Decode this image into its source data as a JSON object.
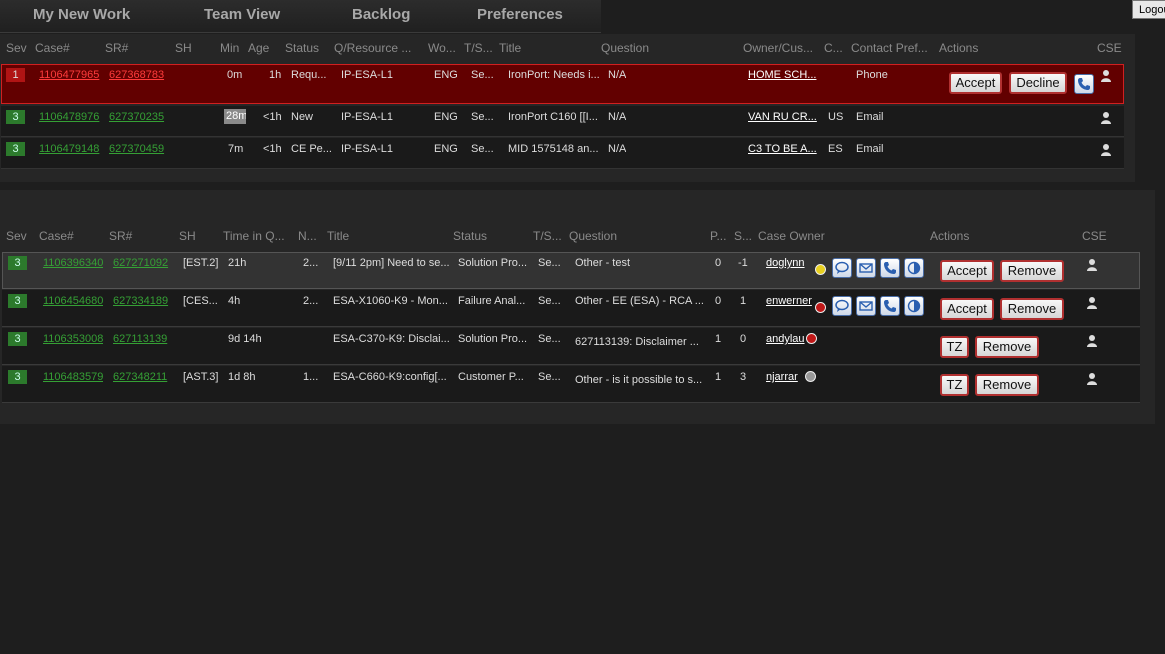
{
  "nav": {
    "tabs": [
      "My New Work",
      "Team View",
      "Backlog",
      "Preferences"
    ],
    "logout": "Logout"
  },
  "colors": {
    "accent_red": "#b01414",
    "sev_green": "#2c7a2c",
    "link_green": "#35a035",
    "link_red": "#ff3b3b"
  },
  "new_work": {
    "headers": [
      "Sev",
      "Case#",
      "SR#",
      "SH",
      "Min",
      "Age",
      "Status",
      "Q/Resource ...",
      "Wo...",
      "T/S...",
      "Title",
      "Question",
      "Owner/Cus...",
      "C...",
      "Contact Pref...",
      "Actions",
      "CSE"
    ],
    "rows": [
      {
        "sev": "1",
        "case": "1106477965",
        "sr": "627368783",
        "sh": "",
        "min": "0m",
        "age": "1h",
        "status": "Requ...",
        "queue": "IP-ESA-L1",
        "wo": "ENG",
        "ts": "Se...",
        "title": "IronPort: Needs i...",
        "question": "N/A",
        "owner": "HOME SCH...",
        "country": "",
        "contact": "Phone",
        "actions": [
          "Accept",
          "Decline"
        ]
      },
      {
        "sev": "3",
        "case": "1106478976",
        "sr": "627370235",
        "sh": "",
        "min": "28m",
        "age": "<1h",
        "status": "New",
        "queue": "IP-ESA-L1",
        "wo": "ENG",
        "ts": "Se...",
        "title": "IronPort C160 [[I...",
        "question": "N/A",
        "owner": "VAN RU CR...",
        "country": "US",
        "contact": "Email",
        "actions": []
      },
      {
        "sev": "3",
        "case": "1106479148",
        "sr": "627370459",
        "sh": "",
        "min": "7m",
        "age": "<1h",
        "status": "CE Pe...",
        "queue": "IP-ESA-L1",
        "wo": "ENG",
        "ts": "Se...",
        "title": "MID 1575148 an...",
        "question": "N/A",
        "owner": "C3 TO BE A...",
        "country": "ES",
        "contact": "Email",
        "actions": []
      }
    ]
  },
  "team": {
    "headers": [
      "Sev",
      "Case#",
      "SR#",
      "SH",
      "Time in Q...",
      "N...",
      "Title",
      "Status",
      "T/S...",
      "Question",
      "P...",
      "S...",
      "Case Owner",
      "Actions",
      "CSE"
    ],
    "rows": [
      {
        "sev": "3",
        "case": "1106396340",
        "sr": "627271092",
        "sh": "[EST.2]",
        "time": "21h",
        "n": "2...",
        "title": "[9/11 2pm] Need to se...",
        "status": "Solution Pro...",
        "ts": "Se...",
        "question": "Other - test",
        "p": "0",
        "s": "-1",
        "owner": "doglynn",
        "presence": "yellow",
        "actions": [
          "Accept",
          "Remove"
        ]
      },
      {
        "sev": "3",
        "case": "1106454680",
        "sr": "627334189",
        "sh": "[CES...",
        "time": "4h",
        "n": "2...",
        "title": "ESA-X1060-K9 - Mon...",
        "status": "Failure Anal...",
        "ts": "Se...",
        "question": "Other - EE (ESA) - RCA ...",
        "p": "0",
        "s": "1",
        "owner": "enwerner",
        "presence": "red",
        "actions": [
          "Accept",
          "Remove"
        ]
      },
      {
        "sev": "3",
        "case": "1106353008",
        "sr": "627113139",
        "sh": "",
        "time": "9d 14h",
        "n": "",
        "title": "ESA-C370-K9: Disclai...",
        "status": "Solution Pro...",
        "ts": "Se...",
        "question": "627113139: Disclaimer ...",
        "p": "1",
        "s": "0",
        "owner": "andylau",
        "presence": "red",
        "actions": [
          "TZ",
          "Remove"
        ]
      },
      {
        "sev": "3",
        "case": "1106483579",
        "sr": "627348211",
        "sh": "[AST.3]",
        "time": "1d 8h",
        "n": "1...",
        "title": "ESA-C660-K9:config[...",
        "status": "Customer P...",
        "ts": "Se...",
        "question": "Other - is it possible to s...",
        "p": "1",
        "s": "3",
        "owner": "njarrar",
        "presence": "gray",
        "actions": [
          "TZ",
          "Remove"
        ]
      }
    ]
  }
}
